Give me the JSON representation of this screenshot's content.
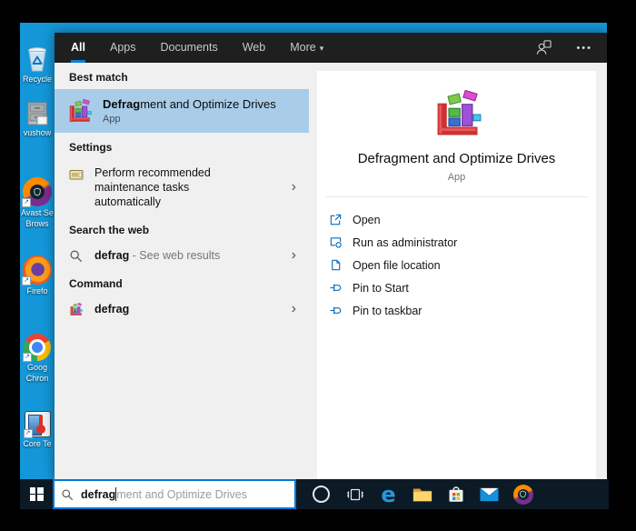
{
  "window": {
    "frame_color": "#000000"
  },
  "glyphs": {
    "chevron_right": "›",
    "dropdown_arrow": "▾",
    "ellipsis": "•••",
    "shortcut_arrow": "↗",
    "edge_e": "e"
  },
  "colors": {
    "accent": "#0078d7",
    "selection": "#a9cde9",
    "desktop_blue": "#1497d8",
    "flyout_header": "#1f1f1f",
    "results_bg": "#f0f0f0",
    "taskbar": "#0c1a26",
    "action_icon_blue": "#0b6cbd"
  },
  "desktop": {
    "icons": [
      {
        "name": "recycle-bin",
        "label_lines": [
          "Recycle"
        ]
      },
      {
        "name": "vushow",
        "label_lines": [
          "vushow"
        ]
      },
      {
        "name": "avast-secure-browser",
        "label_lines": [
          "Avast Se",
          "Brows"
        ]
      },
      {
        "name": "firefox",
        "label_lines": [
          "Firefo"
        ]
      },
      {
        "name": "google-chrome",
        "label_lines": [
          "Goog",
          "Chron"
        ]
      },
      {
        "name": "core-temp",
        "label_lines": [
          "Core Te"
        ]
      }
    ]
  },
  "search_flyout": {
    "tabs": [
      {
        "label": "All",
        "active": true
      },
      {
        "label": "Apps"
      },
      {
        "label": "Documents"
      },
      {
        "label": "Web"
      },
      {
        "label": "More",
        "has_dropdown": true
      }
    ],
    "sections": {
      "best_match": {
        "header": "Best match",
        "item": {
          "title_match": "Defrag",
          "title_rest": "ment and Optimize Drives",
          "subtitle": "App"
        }
      },
      "settings": {
        "header": "Settings",
        "item": {
          "label": "Perform recommended maintenance tasks automatically"
        }
      },
      "web": {
        "header": "Search the web",
        "item": {
          "term": "defrag",
          "hint": " - See web results"
        }
      },
      "command": {
        "header": "Command",
        "item": {
          "term": "defrag"
        }
      }
    },
    "detail": {
      "title": "Defragment and Optimize Drives",
      "subtitle": "App",
      "actions": [
        {
          "icon": "open-icon",
          "label": "Open"
        },
        {
          "icon": "run-admin-icon",
          "label": "Run as administrator"
        },
        {
          "icon": "file-location-icon",
          "label": "Open file location"
        },
        {
          "icon": "pin-start-icon",
          "label": "Pin to Start"
        },
        {
          "icon": "pin-taskbar-icon",
          "label": "Pin to taskbar"
        }
      ]
    }
  },
  "taskbar": {
    "search": {
      "typed": "defrag",
      "suggestion": "ment and Optimize Drives"
    },
    "icons": [
      "start",
      "cortana",
      "task-view",
      "edge",
      "file-explorer",
      "microsoft-store",
      "mail",
      "avast-browser"
    ]
  }
}
